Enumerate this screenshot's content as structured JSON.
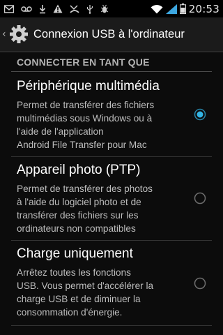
{
  "status_bar": {
    "time": "20:53",
    "icons": [
      "mail-icon",
      "voicemail-icon",
      "download-icon",
      "warning-icon",
      "missed-call-icon",
      "usb-icon",
      "bug-icon",
      "wifi-icon",
      "signal-icon",
      "battery-icon"
    ]
  },
  "action_bar": {
    "title": "Connexion USB à l'ordinateur",
    "icon": "gear-icon"
  },
  "category": {
    "title": "CONNECTER EN TANT QUE"
  },
  "options": [
    {
      "title": "Périphérique multimédia",
      "summary_lines": [
        "Permet de transférer des fichiers",
        "multimédias sous Windows ou à",
        "l'aide de l'application",
        "Android File Transfer pour Mac"
      ],
      "selected": true
    },
    {
      "title": "Appareil photo (PTP)",
      "summary_lines": [
        "Permet de transférer des photos",
        "à l'aide du logiciel photo et de",
        "transférer des fichiers sur les",
        "ordinateurs non compatibles"
      ],
      "selected": false
    },
    {
      "title": "Charge uniquement",
      "summary_lines": [
        "Arrêtez toutes les fonctions",
        "USB. Vous permet d'accélérer la",
        "charge USB et de diminuer la",
        "consommation d'énergie."
      ],
      "selected": false
    }
  ],
  "colors": {
    "accent": "#33b5e5",
    "background": "#0c0c0c",
    "action_bar": "#1b1b1b",
    "signal": "#3da7e0"
  }
}
